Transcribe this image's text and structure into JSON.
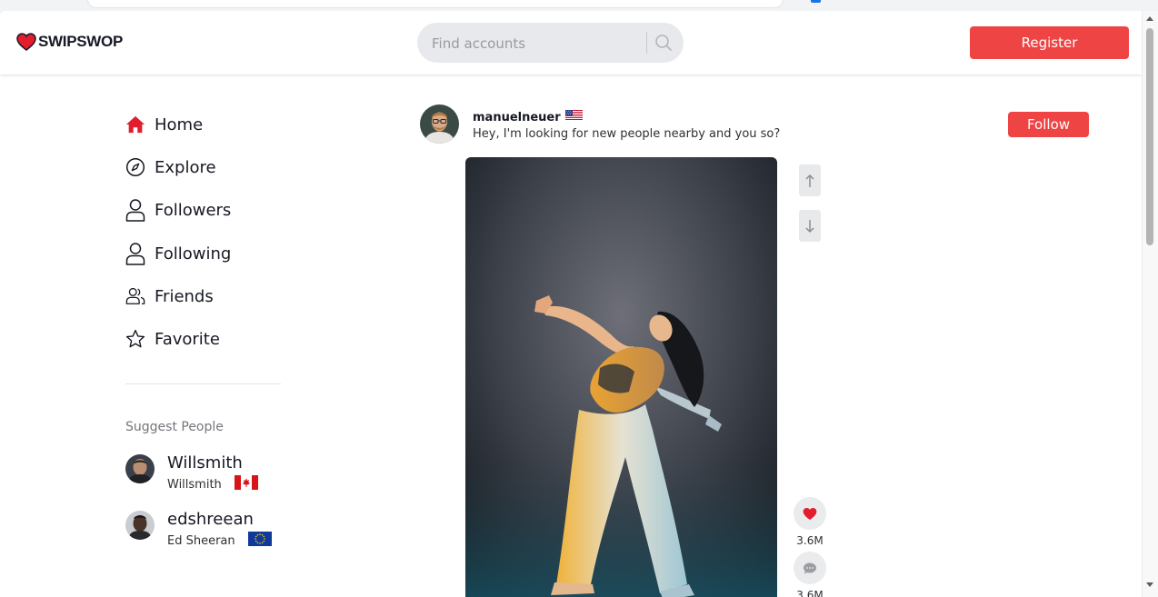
{
  "brand": {
    "name": "SWIPSWOP",
    "accent": "#ef4444",
    "logo_icon": "heart-logo-icon"
  },
  "search": {
    "placeholder": "Find accounts",
    "icon": "search-icon"
  },
  "header": {
    "register_label": "Register"
  },
  "nav": [
    {
      "label": "Home",
      "icon": "home-icon",
      "active": true
    },
    {
      "label": "Explore",
      "icon": "compass-icon"
    },
    {
      "label": "Followers",
      "icon": "user-icon"
    },
    {
      "label": "Following",
      "icon": "user-icon"
    },
    {
      "label": "Friends",
      "icon": "users-icon"
    },
    {
      "label": "Favorite",
      "icon": "star-icon"
    }
  ],
  "suggest": {
    "title": "Suggest People",
    "people": [
      {
        "username": "Willsmith",
        "display_name": "Willsmith",
        "flag": "canada-flag-icon"
      },
      {
        "username": "edshreean",
        "display_name": "Ed Sheeran",
        "flag": "eu-flag-icon"
      }
    ]
  },
  "post": {
    "username": "manuelneuer",
    "flag": "us-flag-icon",
    "caption": "Hey, I'm looking for new people nearby and you so?",
    "follow_label": "Follow",
    "likes": "3.6M",
    "comments": "3.6M"
  }
}
